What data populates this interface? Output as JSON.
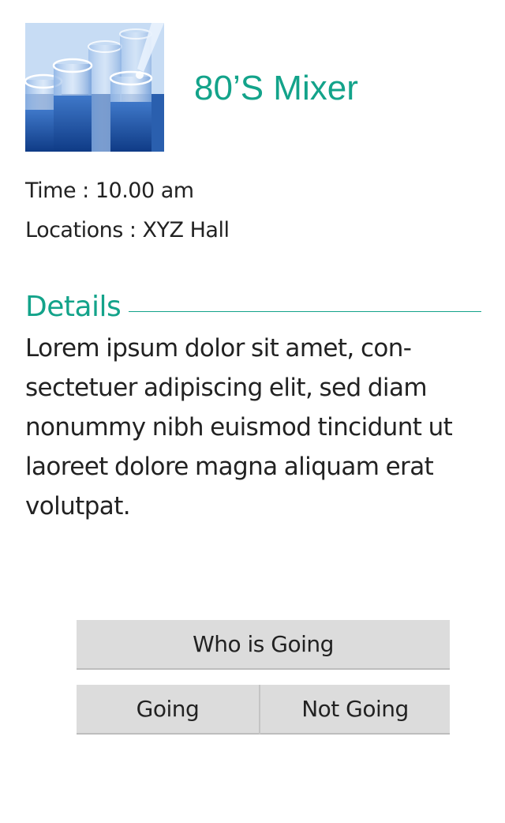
{
  "event": {
    "title": "80’S Mixer",
    "image_icon": "test-tubes-image",
    "time_line": "Time : 10.00 am",
    "location_line": "Locations : XYZ Hall"
  },
  "details": {
    "header": "Details",
    "body": "Lorem ipsum dolor sit amet, con-sectetuer adipiscing elit, sed diam nonummy nibh euismod tincidunt ut laoreet dolore magna aliquam erat volutpat."
  },
  "actions": {
    "who_is_going_label": "Who is Going",
    "going_label": "Going",
    "not_going_label": "Not Going"
  },
  "colors": {
    "accent": "#13a38a",
    "button_bg": "#dcdcdc",
    "text": "#222222"
  }
}
